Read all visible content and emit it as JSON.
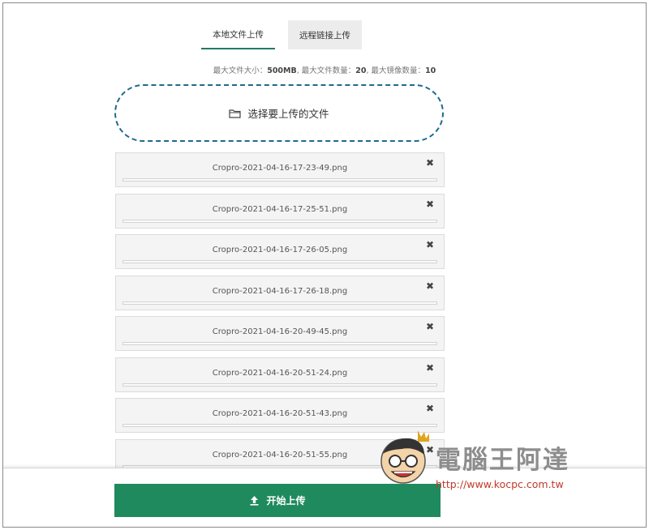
{
  "tabs": [
    {
      "label": "本地文件上传",
      "active": true
    },
    {
      "label": "远程链接上传",
      "active": false
    }
  ],
  "limits": {
    "size_label": "最大文件大小：",
    "size_value": "500MB",
    "count_label": ", 最大文件数量：",
    "count_value": "20",
    "mirror_label": ", 最大镜像数量：",
    "mirror_value": "10"
  },
  "dropzone": {
    "icon": "folder-icon",
    "label": "选择要上传的文件"
  },
  "files": [
    {
      "name": "Cropro-2021-04-16-17-23-49.png",
      "progress": 0
    },
    {
      "name": "Cropro-2021-04-16-17-25-51.png",
      "progress": 0
    },
    {
      "name": "Cropro-2021-04-16-17-26-05.png",
      "progress": 0
    },
    {
      "name": "Cropro-2021-04-16-17-26-18.png",
      "progress": 0
    },
    {
      "name": "Cropro-2021-04-16-20-49-45.png",
      "progress": 0
    },
    {
      "name": "Cropro-2021-04-16-20-51-24.png",
      "progress": 0
    },
    {
      "name": "Cropro-2021-04-16-20-51-43.png",
      "progress": 0
    },
    {
      "name": "Cropro-2021-04-16-20-51-55.png",
      "progress": 0
    }
  ],
  "remove_symbol": "✖",
  "upload_button": {
    "label": "开始上传",
    "icon": "upload-icon"
  },
  "watermark": {
    "text": "電腦王阿達",
    "url": "http://www.kocpc.com.tw"
  },
  "colors": {
    "accent": "#1f8a5e",
    "dashed_border": "#1e6a8c"
  }
}
